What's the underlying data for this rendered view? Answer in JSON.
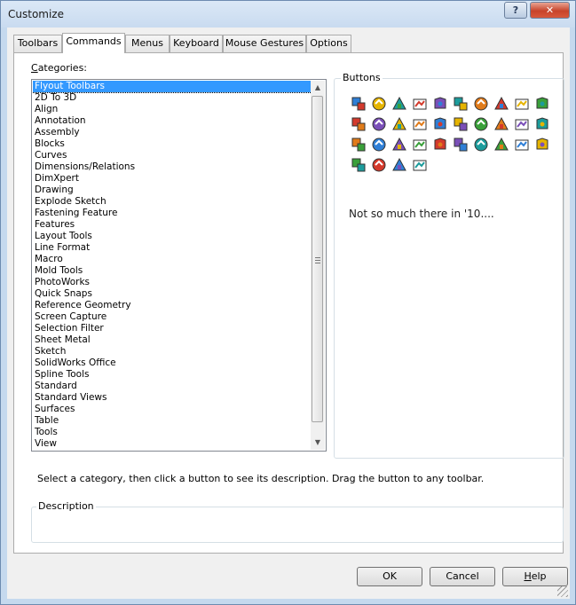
{
  "window": {
    "title": "Customize",
    "help_label": "?",
    "close_label": "✕"
  },
  "tabs": [
    {
      "label": "Toolbars"
    },
    {
      "label": "Commands",
      "active": true
    },
    {
      "label": "Menus"
    },
    {
      "label": "Keyboard"
    },
    {
      "label": "Mouse Gestures"
    },
    {
      "label": "Options"
    }
  ],
  "categories": {
    "label_mnemonic": "C",
    "label_rest": "ategories:",
    "selected": "Flyout Toolbars",
    "items": [
      "Flyout Toolbars",
      "2D To 3D",
      "Align",
      "Annotation",
      "Assembly",
      "Blocks",
      "Curves",
      "Dimensions/Relations",
      "DimXpert",
      "Drawing",
      "Explode Sketch",
      "Fastening Feature",
      "Features",
      "Layout Tools",
      "Line Format",
      "Macro",
      "Mold Tools",
      "PhotoWorks",
      "Quick Snaps",
      "Reference Geometry",
      "Screen Capture",
      "Selection Filter",
      "Sheet Metal",
      "Sketch",
      "SolidWorks Office",
      "Spline Tools",
      "Standard",
      "Standard Views",
      "Surfaces",
      "Table",
      "Tools",
      "View"
    ]
  },
  "buttons_group": {
    "legend": "Buttons",
    "icons": [
      "flyout-align-icon",
      "flyout-annotation-icon",
      "text-a-icon",
      "note-box-icon",
      "assembly-cube-icon",
      "spline-curve-icon",
      "sketch-entity-icon",
      "crosshair-icon",
      "grid-layout-icon",
      "stairs-icon",
      "globe-arrow-icon",
      "bold-italic-icon",
      "surface-icon",
      "line-format-icon",
      "macro-run-icon",
      "mold-box-icon",
      "target-icon",
      "sparkle-icon",
      "screen-capture-icon",
      "filter-icon",
      "sheet-metal-icon",
      "sketch-pencil-icon",
      "solidworks-office-icon",
      "spline-icon",
      "save-icon",
      "standard-views-icon",
      "surface-patch-icon",
      "table-icon",
      "tools-icon",
      "view-icon",
      "globe-icon",
      "dimxpert-icon",
      "photoworks-icon",
      "reference-geometry-icon"
    ],
    "note": "Not so much there in '10...."
  },
  "hint": "Select a category, then click a button to see its description. Drag the button to any toolbar.",
  "description": {
    "legend": "Description",
    "text": ""
  },
  "footer": {
    "ok_label": "OK",
    "cancel_label": "Cancel",
    "help_mnemonic": "H",
    "help_rest": "elp"
  }
}
